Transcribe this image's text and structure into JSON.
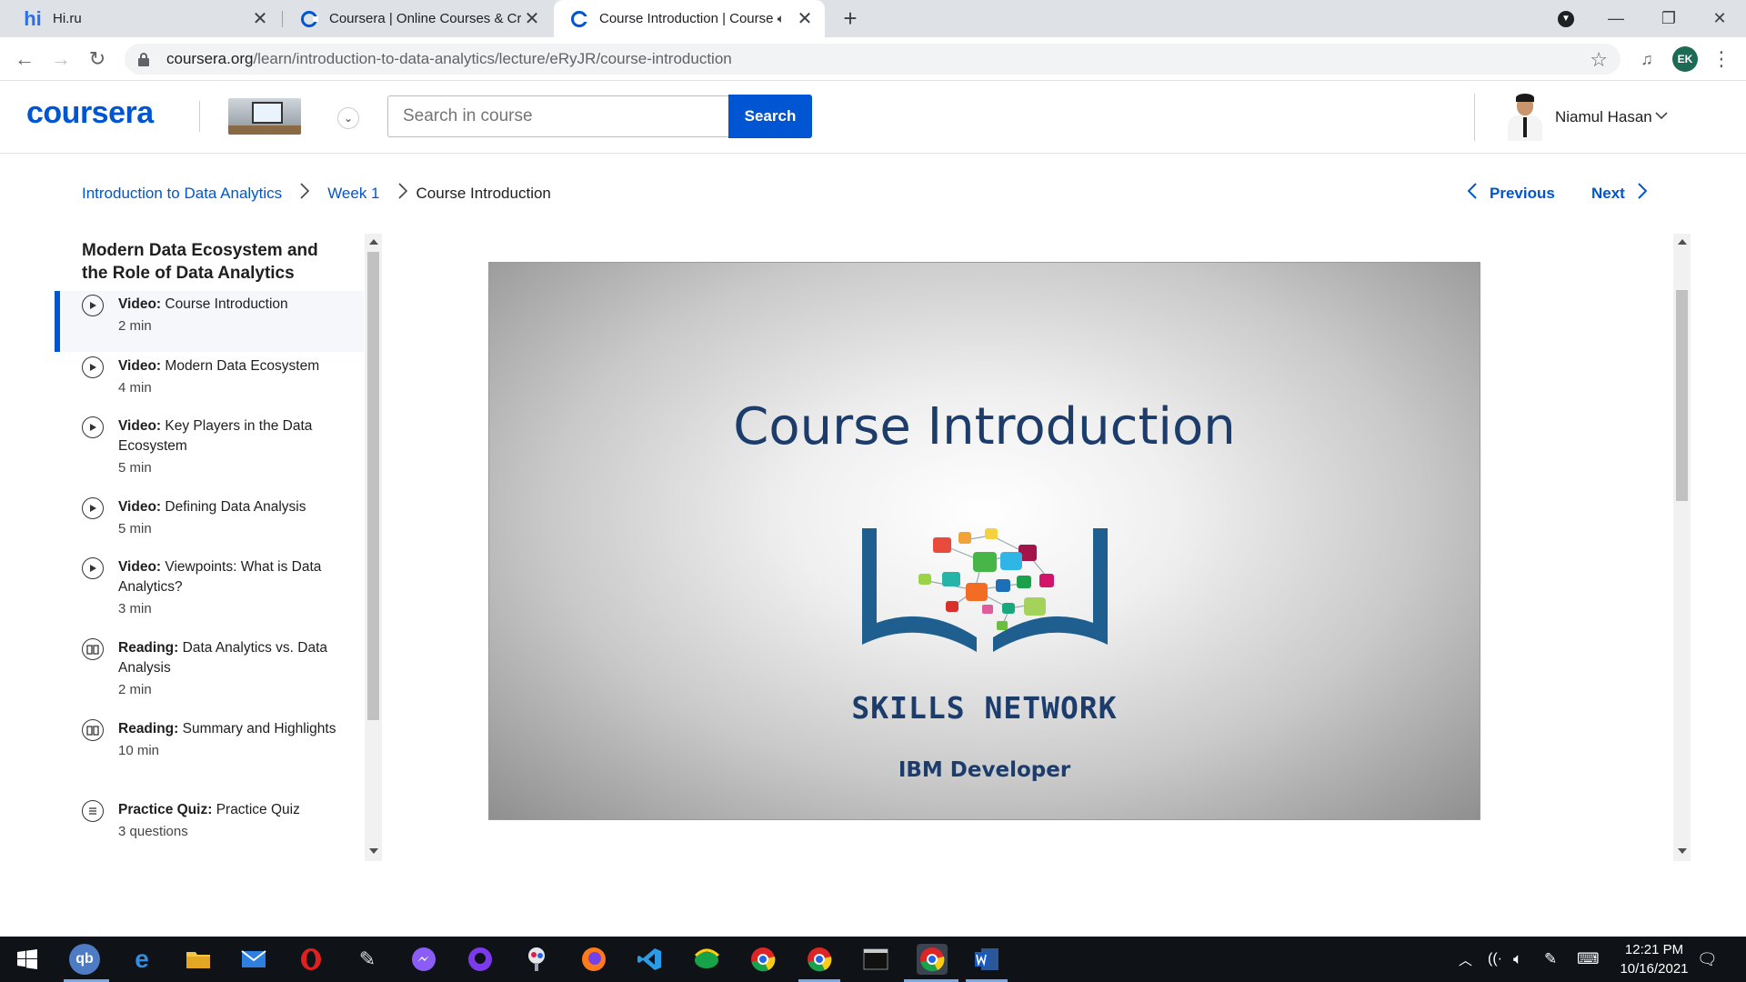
{
  "browser": {
    "tabs": [
      {
        "title": "Hi.ru",
        "favicon": "hi-icon"
      },
      {
        "title": "Coursera | Online Courses & Crec",
        "favicon": "coursera-icon"
      },
      {
        "title": "Course Introduction | Course",
        "favicon": "coursera-icon",
        "active": true,
        "audio": true
      }
    ],
    "url_host": "coursera.org",
    "url_path": "/learn/introduction-to-data-analytics/lecture/eRyJR/course-introduction",
    "profile_initials": "EK"
  },
  "header": {
    "logo": "coursera",
    "search_placeholder": "Search in course",
    "search_button": "Search",
    "user_name": "Niamul Hasan"
  },
  "breadcrumb": {
    "items": [
      "Introduction to Data Analytics",
      "Week 1"
    ],
    "current": "Course Introduction"
  },
  "nav": {
    "previous": "Previous",
    "next": "Next"
  },
  "sidebar": {
    "module_title": "Modern Data Ecosystem and the Role of Data Analytics",
    "items": [
      {
        "type": "Video:",
        "title": "Course Introduction",
        "meta": "2 min",
        "icon": "play-icon",
        "active": true
      },
      {
        "type": "Video:",
        "title": "Modern Data Ecosystem",
        "meta": "4 min",
        "icon": "play-icon"
      },
      {
        "type": "Video:",
        "title": "Key Players in the Data Ecosystem",
        "meta": "5 min",
        "icon": "play-icon"
      },
      {
        "type": "Video:",
        "title": "Defining Data Analysis",
        "meta": "5 min",
        "icon": "play-icon"
      },
      {
        "type": "Video:",
        "title": "Viewpoints: What is Data Analytics?",
        "meta": "3 min",
        "icon": "play-icon"
      },
      {
        "type": "Reading:",
        "title": "Data Analytics vs. Data Analysis",
        "meta": "2 min",
        "icon": "book-icon"
      },
      {
        "type": "Reading:",
        "title": "Summary and Highlights",
        "meta": "10 min",
        "icon": "book-icon"
      },
      {
        "type": "Practice Quiz:",
        "title": "Practice Quiz",
        "meta": "3 questions",
        "icon": "quiz-icon"
      }
    ]
  },
  "video": {
    "title": "Course Introduction",
    "brand": "SKILLS NETWORK",
    "subtitle": "IBM Developer"
  },
  "taskbar": {
    "time": "12:21 PM",
    "date": "10/16/2021"
  },
  "colors": {
    "accent": "#0056d2",
    "title_navy": "#1c3d6b"
  }
}
